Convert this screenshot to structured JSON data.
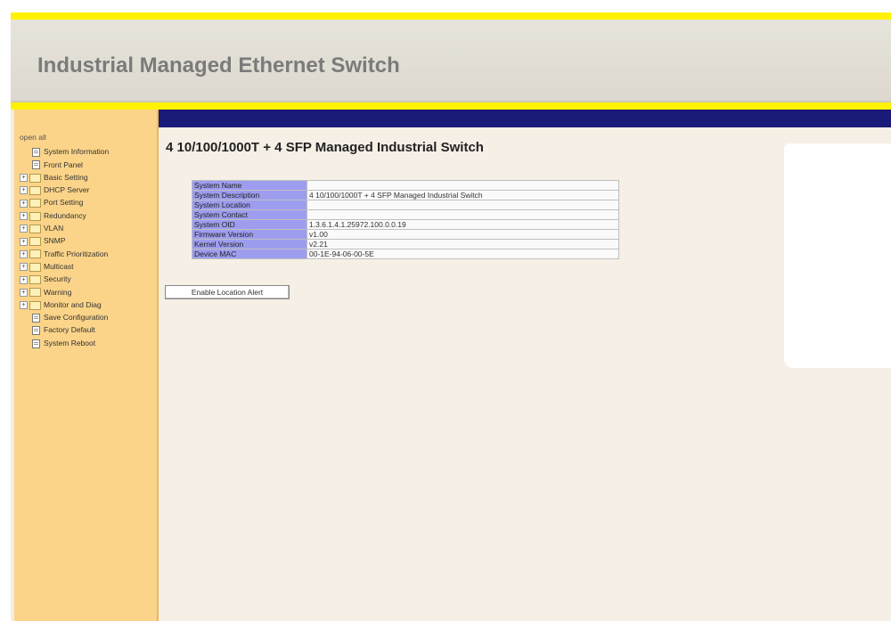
{
  "header": {
    "title": "Industrial Managed Ethernet Switch"
  },
  "sidebar": {
    "root_label": "open all",
    "items": [
      {
        "label": "System Information",
        "type": "page"
      },
      {
        "label": "Front Panel",
        "type": "page"
      },
      {
        "label": "Basic Setting",
        "type": "folder"
      },
      {
        "label": "DHCP Server",
        "type": "folder"
      },
      {
        "label": "Port Setting",
        "type": "folder"
      },
      {
        "label": "Redundancy",
        "type": "folder"
      },
      {
        "label": "VLAN",
        "type": "folder"
      },
      {
        "label": "SNMP",
        "type": "folder"
      },
      {
        "label": "Traffic Prioritization",
        "type": "folder"
      },
      {
        "label": "Multicast",
        "type": "folder"
      },
      {
        "label": "Security",
        "type": "folder"
      },
      {
        "label": "Warning",
        "type": "folder"
      },
      {
        "label": "Monitor and Diag",
        "type": "folder"
      },
      {
        "label": "Save Configuration",
        "type": "page"
      },
      {
        "label": "Factory Default",
        "type": "page"
      },
      {
        "label": "System Reboot",
        "type": "page"
      }
    ]
  },
  "main": {
    "title": "4 10/100/1000T + 4 SFP Managed Industrial Switch",
    "rows": [
      {
        "label": "System Name",
        "value": ""
      },
      {
        "label": "System Description",
        "value": "4 10/100/1000T + 4 SFP Managed Industrial Switch"
      },
      {
        "label": "System Location",
        "value": ""
      },
      {
        "label": "System Contact",
        "value": ""
      },
      {
        "label": "System OID",
        "value": "1.3.6.1.4.1.25972.100.0.0.19"
      },
      {
        "label": "Firmware Version",
        "value": "v1.00"
      },
      {
        "label": "Kernel Version",
        "value": "v2.21"
      },
      {
        "label": "Device MAC",
        "value": "00-1E-94-06-00-5E"
      }
    ],
    "enable_alert_button": "Enable Location Alert"
  },
  "colors": {
    "accent_yellow": "#fff200",
    "sidebar_bg": "#fbd489",
    "navy_bar": "#1a1a78",
    "table_key_bg": "#9d9df0"
  }
}
